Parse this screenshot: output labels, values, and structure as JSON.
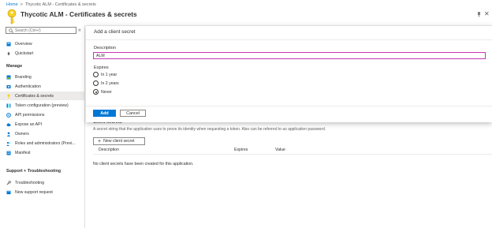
{
  "breadcrumb": {
    "home": "Home",
    "separator": ">",
    "current": "Thycotic ALM - Certificates & secrets"
  },
  "title": "Thycotic ALM - Certificates & secrets",
  "icons": {
    "app": "key-icon",
    "pin": "pin-icon",
    "close": "close-icon"
  },
  "sidebar": {
    "search_placeholder": "Search (Ctrl+/)",
    "collapse": "«",
    "top_items": [
      {
        "label": "Overview",
        "icon": "overview-icon"
      },
      {
        "label": "Quickstart",
        "icon": "quickstart-icon"
      }
    ],
    "manage_header": "Manage",
    "manage_items": [
      {
        "label": "Branding",
        "icon": "branding-icon"
      },
      {
        "label": "Authentication",
        "icon": "authentication-icon"
      },
      {
        "label": "Certificates & secrets",
        "icon": "key-icon",
        "active": true
      },
      {
        "label": "Token configuration (preview)",
        "icon": "token-icon"
      },
      {
        "label": "API permissions",
        "icon": "api-permissions-icon"
      },
      {
        "label": "Expose an API",
        "icon": "cloud-icon"
      },
      {
        "label": "Owners",
        "icon": "owners-icon"
      },
      {
        "label": "Roles and administrators (Previ...",
        "icon": "roles-icon"
      },
      {
        "label": "Manifest",
        "icon": "manifest-icon"
      }
    ],
    "support_header": "Support + Troubleshooting",
    "support_items": [
      {
        "label": "Troubleshooting",
        "icon": "wrench-icon"
      },
      {
        "label": "New support request",
        "icon": "support-icon"
      }
    ]
  },
  "panel": {
    "title": "Add a client secret",
    "description_label": "Description",
    "description_value": "ALM",
    "expires_label": "Expires",
    "options": [
      "In 1 year",
      "In 2 years",
      "Never"
    ],
    "selected_option": "Never",
    "add_label": "Add",
    "cancel_label": "Cancel"
  },
  "main": {
    "section_peek": "Client secrets",
    "description": "A secret string that the application uses to prove its identity when requesting a token. Also can be referred to as application password.",
    "new_secret_label": "New client secret",
    "columns": [
      "Description",
      "Expires",
      "Value"
    ],
    "empty_message": "No client secrets have been created for this application."
  },
  "colors": {
    "accent": "#0078d4",
    "focus_border": "#c239b3",
    "key_yellow": "#f8d22a"
  }
}
